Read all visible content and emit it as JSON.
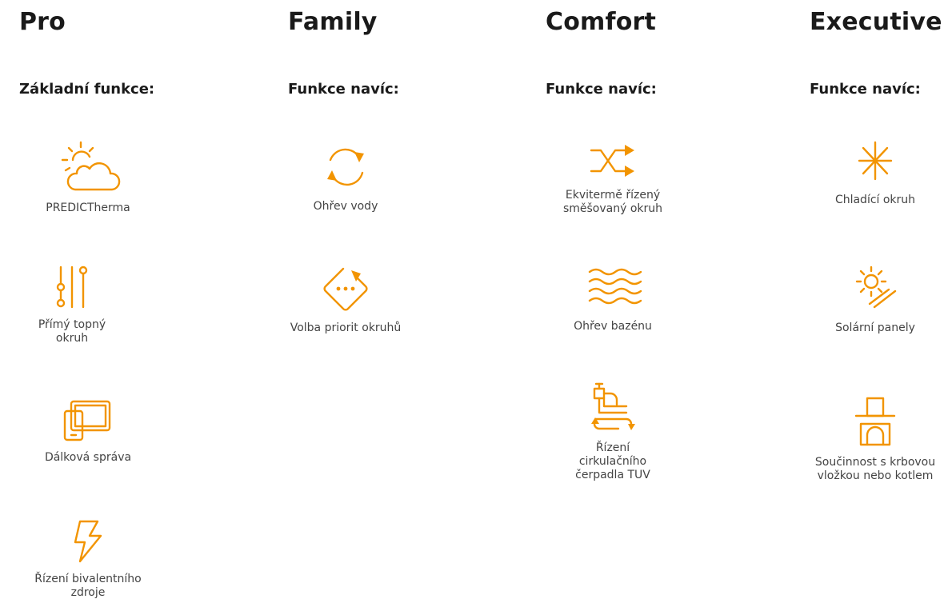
{
  "accent_color": "#f29400",
  "columns": [
    {
      "title": "Pro",
      "subtitle": "Základní funkce:",
      "features": [
        {
          "icon": "sun-cloud-icon",
          "label": "PREDICTherma"
        },
        {
          "icon": "sliders-icon",
          "label": "Přímý topný\nokruh"
        },
        {
          "icon": "devices-icon",
          "label": "Dálková správa"
        },
        {
          "icon": "lightning-icon",
          "label": "Řízení bivalentního\nzdroje"
        }
      ]
    },
    {
      "title": "Family",
      "subtitle": "Funkce navíc:",
      "features": [
        {
          "icon": "circular-arrows-icon",
          "label": "Ohřev vody"
        },
        {
          "icon": "priority-diamond-icon",
          "label": "Volba priorit okruhů"
        }
      ]
    },
    {
      "title": "Comfort",
      "subtitle": "Funkce navíc:",
      "features": [
        {
          "icon": "shuffle-icon",
          "label": "Ekvitermě řízený\nsměšovaný okruh"
        },
        {
          "icon": "waves-icon",
          "label": "Ohřev bazénu"
        },
        {
          "icon": "circulation-pump-icon",
          "label": "Řízení\ncirkulačního\nčerpadla TUV"
        }
      ]
    },
    {
      "title": "Executive",
      "subtitle": "Funkce navíc:",
      "features": [
        {
          "icon": "snowflake-icon",
          "label": "Chladící okruh"
        },
        {
          "icon": "solar-panel-icon",
          "label": "Solární panely"
        },
        {
          "icon": "fireplace-icon",
          "label": "Součinnost s krbovou\nvložkou nebo kotlem"
        }
      ]
    }
  ]
}
